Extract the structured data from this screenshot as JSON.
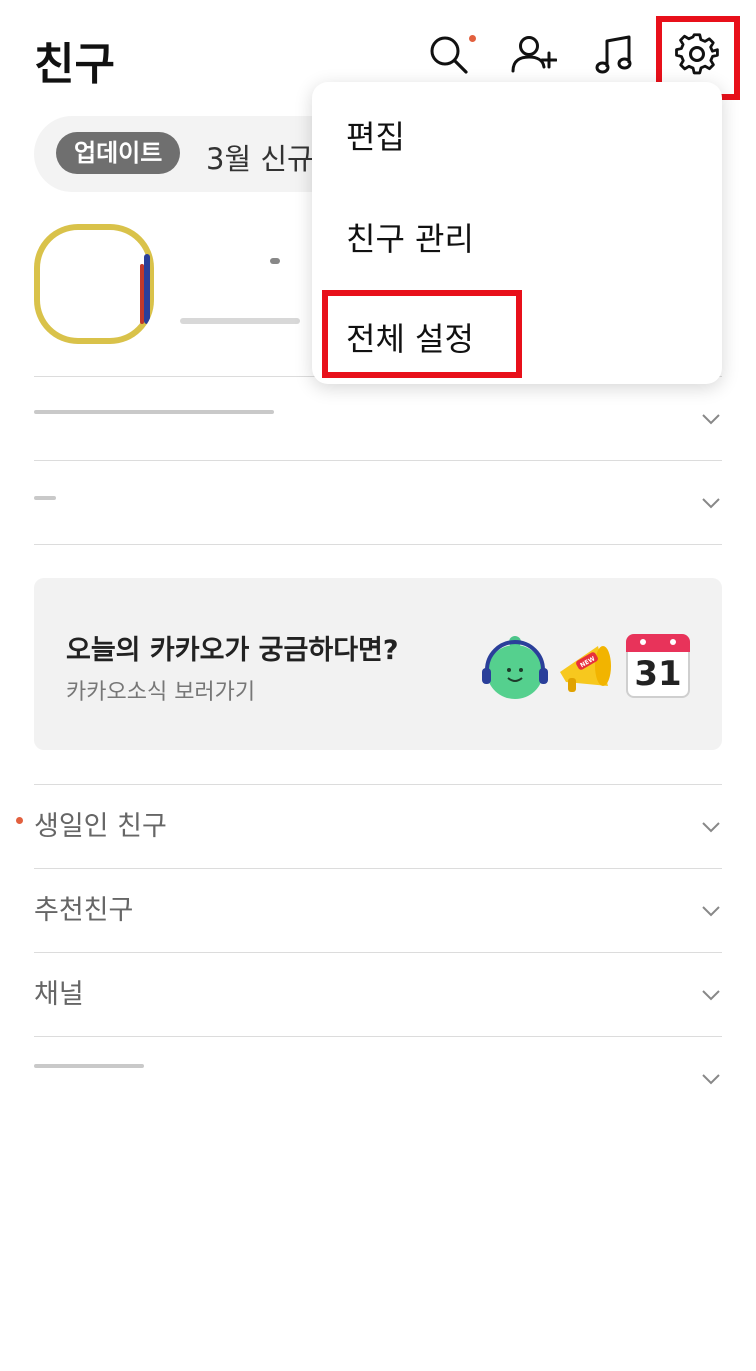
{
  "header": {
    "title": "친구",
    "icons": [
      "search-icon",
      "add-friend-icon",
      "music-icon",
      "settings-icon"
    ]
  },
  "update": {
    "badge": "업데이트",
    "text": "3월 신규"
  },
  "menu": {
    "items": [
      "편집",
      "친구 관리",
      "전체 설정"
    ]
  },
  "banner": {
    "title": "오늘의 카카오가 궁금하다면?",
    "subtitle": "카카오소식 보러가기",
    "calendar_day": "31",
    "megaphone_tag": "NEW"
  },
  "sections": [
    {
      "label": "생일인 친구"
    },
    {
      "label": "추천친구"
    },
    {
      "label": "채널"
    }
  ],
  "colors": {
    "highlight": "#e8101a",
    "dot": "#e2603e",
    "badge": "#6f6f6f"
  }
}
